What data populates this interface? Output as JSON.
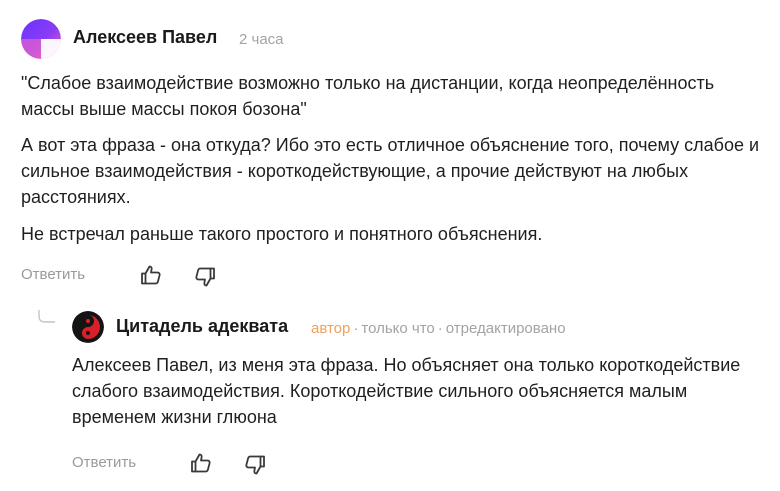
{
  "comment": {
    "author": "Алексеев Павел",
    "time": "2 часа",
    "avatar_icon": "avatar-gradient-icon",
    "paragraphs": [
      "\"Слабое взаимодействие возможно только на дистанции, когда неопределённость массы выше массы покоя бозона\"",
      "А вот эта фраза - она откуда? Ибо это есть отличное объяснение того, почему слабое и сильное взаимодействия - короткодействующие, а прочие действуют на любых расстояниях.",
      "Не встречал раньше такого простого и понятного объяснения."
    ],
    "reply_label": "Ответить",
    "like_icon": "thumbs-up-icon",
    "dislike_icon": "thumbs-down-icon"
  },
  "reply": {
    "author": "Цитадель адеквата",
    "badge": "автор",
    "time": "только что",
    "edited": "отредактировано",
    "avatar_icon": "yin-yang-avatar-icon",
    "text": "Алексеев Павел, из меня эта фраза. Но объясняет она только короткодействие слабого взаимодействия. Короткодействие сильного объясняется малым временем жизни глюона",
    "reply_label": "Ответить",
    "like_icon": "thumbs-up-icon",
    "dislike_icon": "thumbs-down-icon"
  },
  "colors": {
    "badge": "#f0a15c",
    "muted": "#9a9a9a",
    "avatar_gradient_start": "#7b3bff",
    "avatar_gradient_end": "#ff4fb0"
  }
}
